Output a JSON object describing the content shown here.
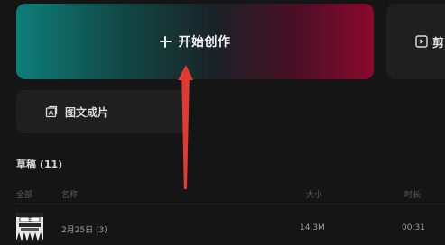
{
  "start_card": {
    "label": "开始创作"
  },
  "side_card": {
    "label": "剪"
  },
  "image_card": {
    "label": "图文成片"
  },
  "drafts": {
    "title": "草稿 (11)"
  },
  "table": {
    "headers": {
      "all": "全部",
      "name": "名称",
      "size": "大小",
      "duration": "时长"
    },
    "rows": [
      {
        "name": "2月25日 (3)",
        "size": "14.3M",
        "duration": "00:31"
      }
    ]
  },
  "colors": {
    "gradient_left": "#0d7e79",
    "gradient_right": "#8b0a2e",
    "annotation_arrow": "#e23a32",
    "background": "#151515"
  },
  "icons": {
    "start": "plus-icon",
    "side": "video-clip-icon",
    "image": "image-text-icon",
    "annotation": "red-arrow-icon"
  }
}
